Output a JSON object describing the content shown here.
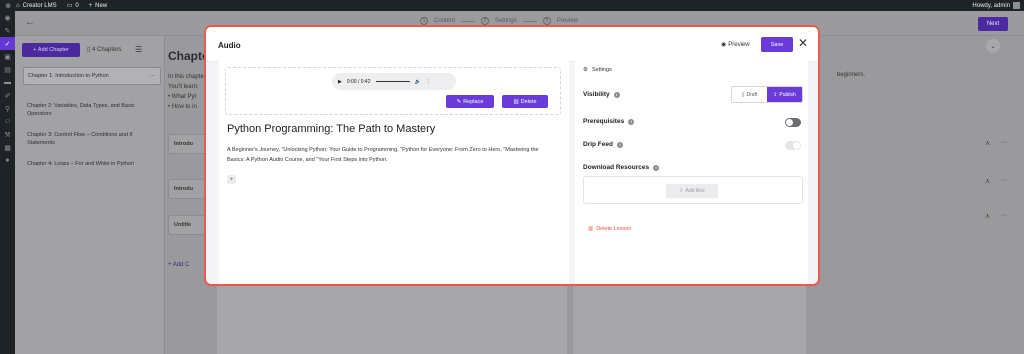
{
  "adminbar": {
    "site_name": "Creator LMS",
    "comments_count": "0",
    "new_label": "New",
    "howdy": "Howdy, admin"
  },
  "topbar": {
    "steps": [
      {
        "num": "1",
        "label": "Content"
      },
      {
        "num": "2",
        "label": "Settings"
      },
      {
        "num": "3",
        "label": "Preview"
      }
    ],
    "next_label": "Next"
  },
  "sidebar": {
    "add_chapter_label": "Add Chapter",
    "chapters_count_label": "4 Chapters",
    "chapters": [
      {
        "label": "Chapter 1: Introduction to Python"
      },
      {
        "label": "Chapter 2: Variables, Data Types, and Basic Operators"
      },
      {
        "label": "Chapter 3: Control Flow – Conditions and If Statements"
      },
      {
        "label": "Chapter 4: Loops – For and While in Python"
      }
    ]
  },
  "background": {
    "title": "Chapte",
    "text_lines": [
      "In this chapte",
      "You'll learn:"
    ],
    "bullets": [
      "What Pyt",
      "How to in"
    ],
    "right_text": "beginners.",
    "rows": [
      "Introdu",
      "Introdu",
      "Untitle"
    ],
    "add_label": "+ Add C"
  },
  "modal": {
    "title": "Audio",
    "preview_label": "Preview",
    "save_label": "Save",
    "player_time": "0:00 / 0:42",
    "replace_label": "Replace",
    "delete_label": "Delete",
    "lesson_title": "Python Programming: The Path to Mastery",
    "lesson_description": "A Beginner's Journey, \"Unlocking Python: Your Guide to Programming, \"Python for Everyone: From Zero to Hero, \"Mastering the Basics: A Python Audio Course, and \"Your First Steps into Python.",
    "settings": {
      "header": "Settings",
      "visibility_label": "Visibility",
      "draft_label": "Draft",
      "publish_label": "Publish",
      "prerequisites_label": "Prerequisites",
      "drip_feed_label": "Drip Feed",
      "download_resources_label": "Download Resources",
      "add_files_label": "Add files",
      "delete_lesson_label": "Delete Lesson"
    }
  }
}
